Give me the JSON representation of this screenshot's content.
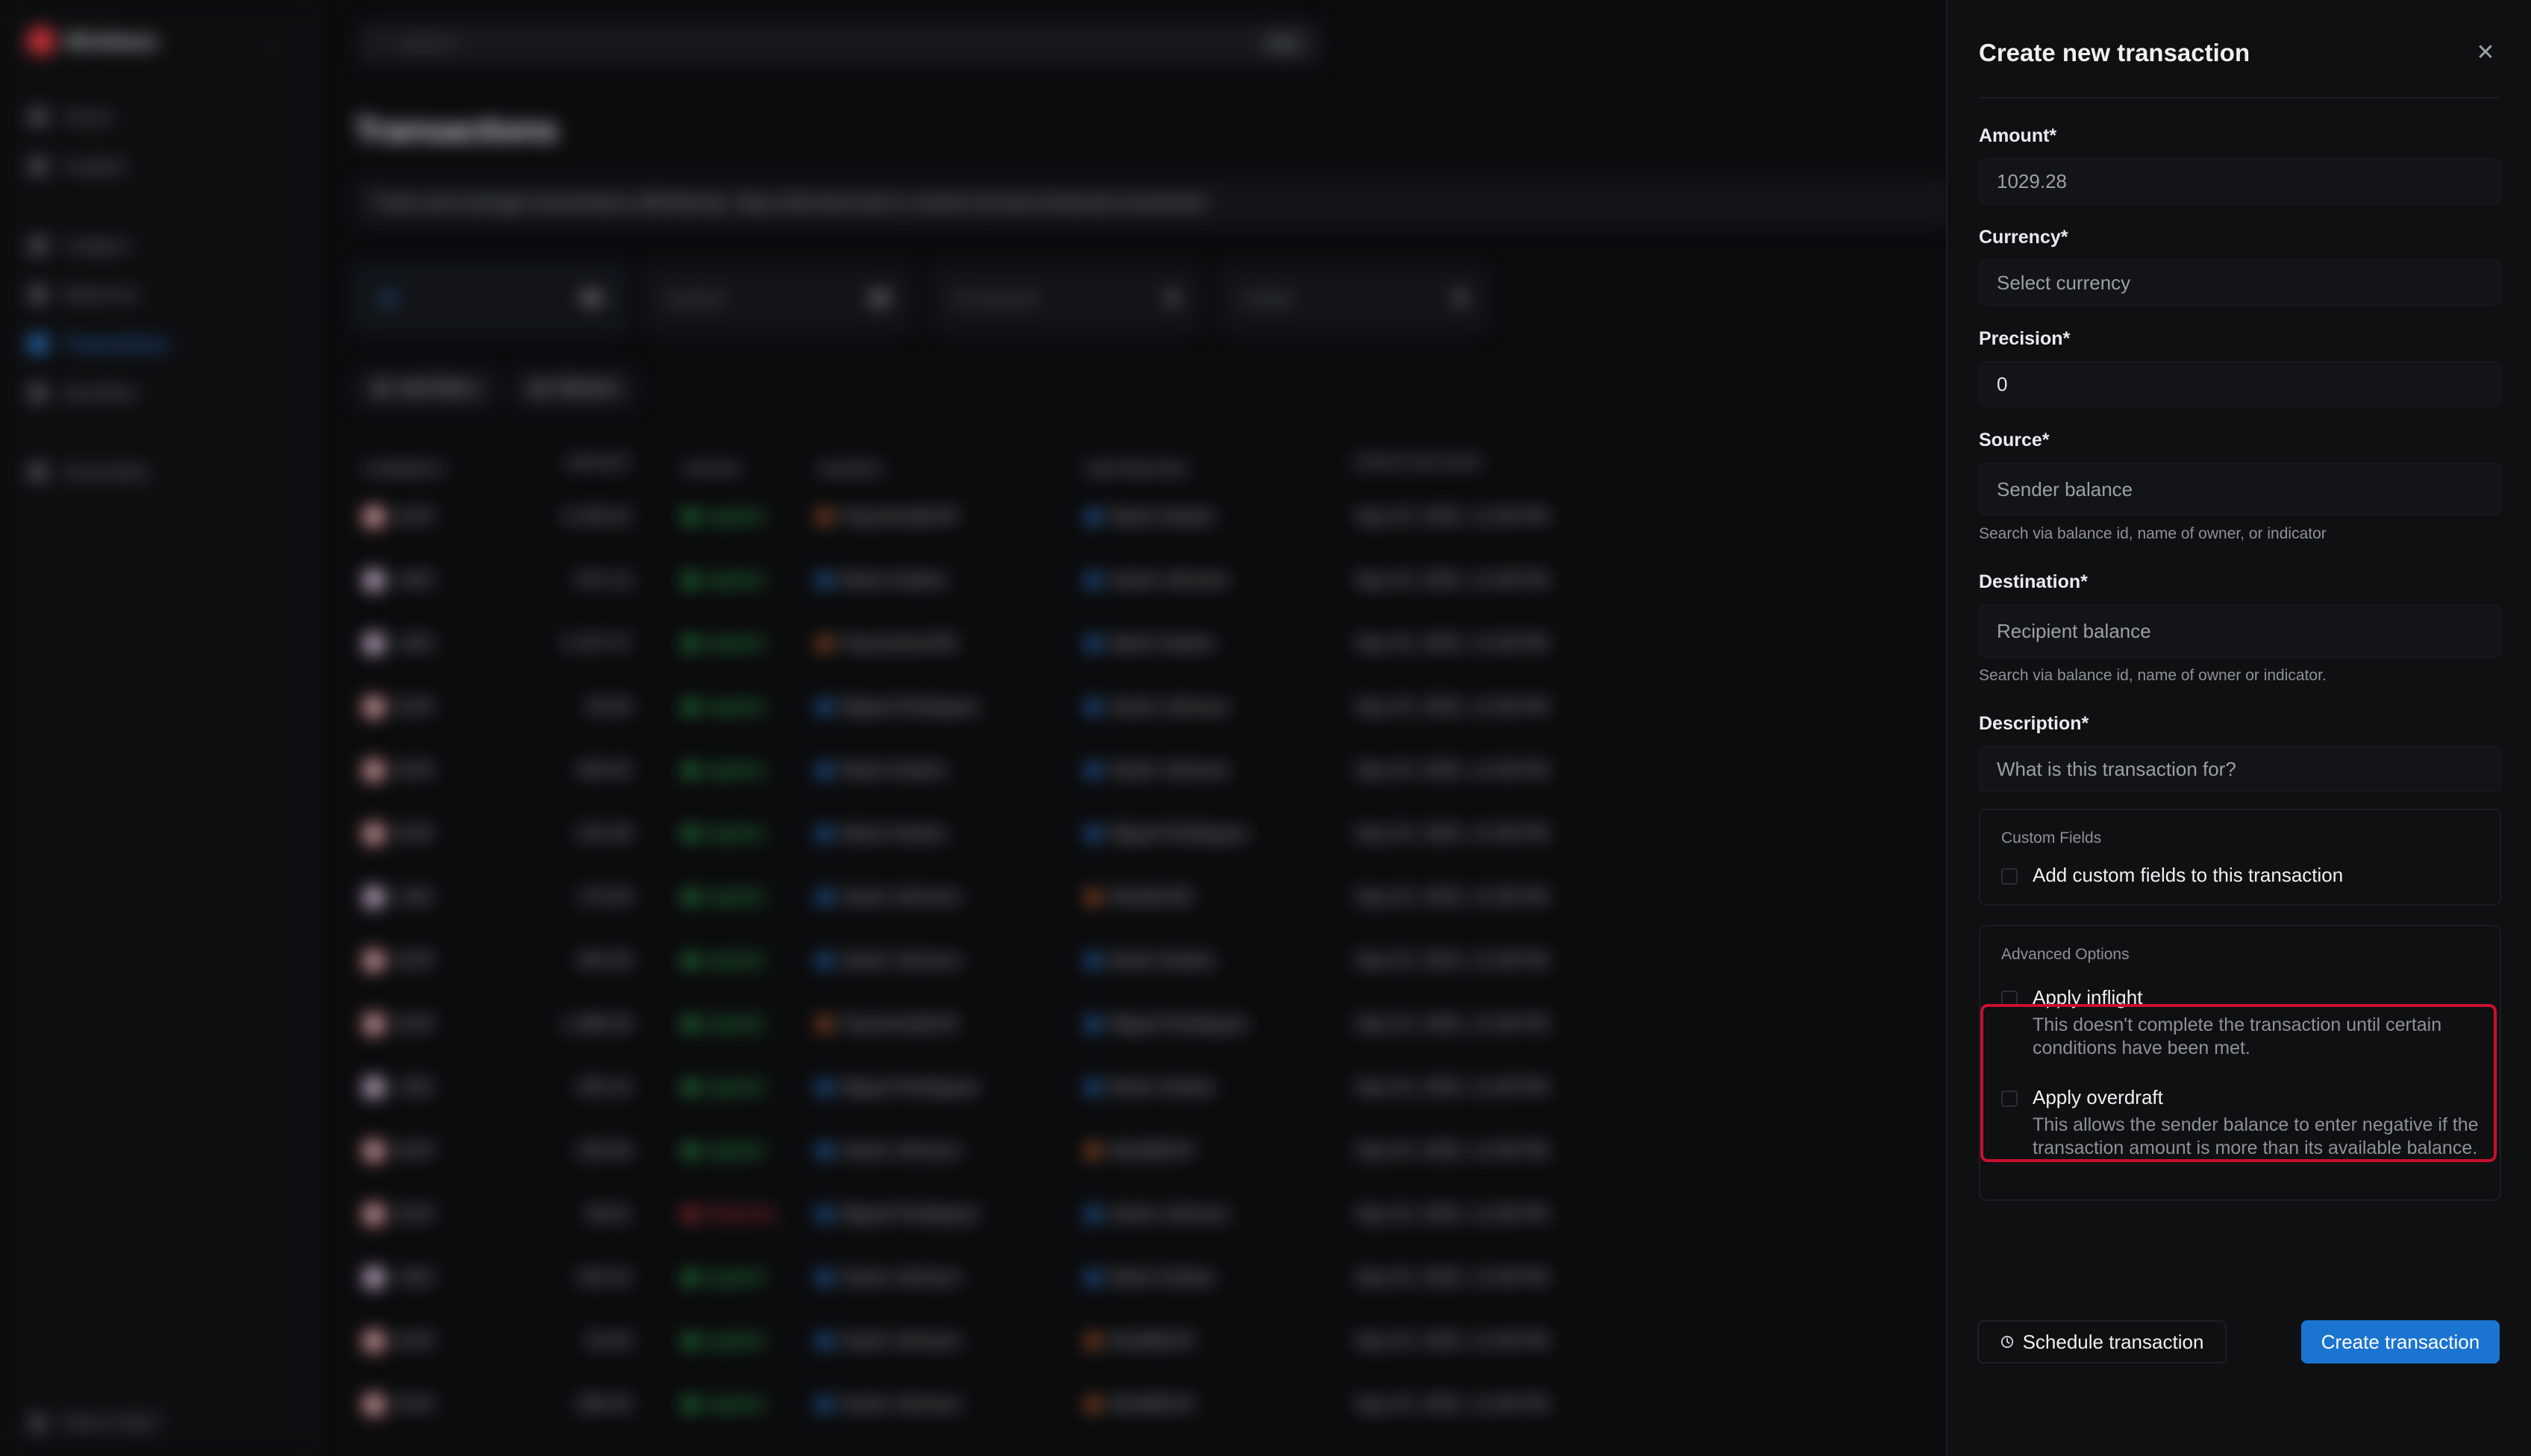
{
  "app": {
    "brand": "Blinkbase",
    "nav": [
      "Home",
      "Insights",
      "Ledgers",
      "Balances",
      "Transactions",
      "Identities",
      "Anomalies"
    ],
    "active_nav": "Transactions",
    "help": "Need Help?",
    "search_placeholder": "Search",
    "search_kbd": "⌘K",
    "page_title": "Transactions",
    "page_subtitle": "Track and manage transactions effortlessly. Stay informed and in control of every financial movement",
    "stats": [
      {
        "label": "All",
        "count": "99"
      },
      {
        "label": "Applied",
        "count": "20"
      },
      {
        "label": "Scheduled",
        "count": "0"
      },
      {
        "label": "Inflight",
        "count": "0"
      }
    ],
    "toolbar": {
      "filters": "Add filters",
      "refresh": "Refresh"
    },
    "columns": [
      "CURRENCY",
      "AMOUNT",
      "STATUS",
      "SOURCE",
      "DESTINATION",
      "EFFECTIVE DATE"
    ],
    "rows": [
      {
        "cur": "EUR",
        "amt": "3,109.32",
        "status": "Applied",
        "src": "PaymentsEUR",
        "dst": "Marie Dubois",
        "date": "Sep 25, 2025, 12:38 PM"
      },
      {
        "cur": "USD",
        "amt": "974.13",
        "status": "Applied",
        "src": "Marie Dubois",
        "dst": "Sarah Johnson",
        "date": "Sep 25, 2025, 12:38 PM"
      },
      {
        "cur": "USD",
        "amt": "3,767.57",
        "status": "Applied",
        "src": "PaymentsUSD",
        "dst": "Marie Dubois",
        "date": "Sep 25, 2025, 12:38 PM"
      },
      {
        "cur": "EUR",
        "amt": "50.83",
        "status": "Applied",
        "src": "Miguel Rodriguez",
        "dst": "Sarah Johnson",
        "date": "Sep 25, 2025, 12:38 PM"
      },
      {
        "cur": "EUR",
        "amt": "450.92",
        "status": "Applied",
        "src": "Marie Dubois",
        "dst": "Sarah Johnson",
        "date": "Sep 25, 2025, 12:38 PM"
      },
      {
        "cur": "EUR",
        "amt": "223.38",
        "status": "Applied",
        "src": "Marie Dubois",
        "dst": "Miguel Rodriguez",
        "date": "Sep 25, 2025, 12:38 PM"
      },
      {
        "cur": "USD",
        "amt": "179.49",
        "status": "Applied",
        "src": "Sarah Johnson",
        "dst": "WorldUSD",
        "date": "Sep 25, 2025, 12:38 PM"
      },
      {
        "cur": "EUR",
        "amt": "494.58",
        "status": "Applied",
        "src": "Sarah Johnson",
        "dst": "Marie Dubois",
        "date": "Sep 25, 2025, 12:38 PM"
      },
      {
        "cur": "EUR",
        "amt": "1,388.39",
        "status": "Applied",
        "src": "PaymentsEUR",
        "dst": "Miguel Rodriguez",
        "date": "Sep 25, 2025, 12:38 PM"
      },
      {
        "cur": "USD",
        "amt": "335.32",
        "status": "Applied",
        "src": "Miguel Rodriguez",
        "dst": "Marie Dubois",
        "date": "Sep 25, 2025, 12:38 PM"
      },
      {
        "cur": "EUR",
        "amt": "228.08",
        "status": "Applied",
        "src": "Sarah Johnson",
        "dst": "WorldEUR",
        "date": "Sep 25, 2025, 12:38 PM"
      },
      {
        "cur": "EUR",
        "amt": "99.81",
        "status": "Rejected",
        "src": "Miguel Rodriguez",
        "dst": "Sarah Johnson",
        "date": "Sep 25, 2025, 12:38 PM"
      },
      {
        "cur": "USD",
        "amt": "333.42",
        "status": "Applied",
        "src": "Sarah Johnson",
        "dst": "Marie Dubois",
        "date": "Sep 25, 2025, 12:38 PM"
      },
      {
        "cur": "EUR",
        "amt": "92.93",
        "status": "Applied",
        "src": "Sarah Johnson",
        "dst": "WorldEUR",
        "date": "Sep 25, 2025, 12:38 PM"
      },
      {
        "cur": "EUR",
        "amt": "280.05",
        "status": "Applied",
        "src": "Sarah Johnson",
        "dst": "WorldEUR",
        "date": "Sep 25, 2025, 12:38 PM"
      }
    ]
  },
  "panel": {
    "title": "Create new transaction",
    "close_icon": "close-icon",
    "amount": {
      "label": "Amount*",
      "value": "1029.28"
    },
    "currency": {
      "label": "Currency*",
      "placeholder": "Select currency"
    },
    "precision": {
      "label": "Precision*",
      "value": "0"
    },
    "source": {
      "label": "Source*",
      "placeholder": "Sender balance",
      "hint": "Search via balance id, name of owner, or indicator"
    },
    "destination": {
      "label": "Destination*",
      "placeholder": "Recipient balance",
      "hint": "Search via balance id, name of owner or indicator."
    },
    "description": {
      "label": "Description*",
      "placeholder": "What is this transaction for?"
    },
    "custom_fields": {
      "title": "Custom Fields",
      "checkbox_label": "Add custom fields to this transaction"
    },
    "advanced": {
      "title": "Advanced Options",
      "inflight": {
        "label": "Apply inflight",
        "desc": "This doesn't complete the transaction until certain conditions have been met."
      },
      "overdraft": {
        "label": "Apply overdraft",
        "desc": "This allows the sender balance to enter negative if the transaction amount is more than its available balance."
      }
    },
    "schedule_button": "Schedule transaction",
    "create_button": "Create transaction",
    "accent": "#1a74d0",
    "highlight_color": "#c8102e"
  }
}
